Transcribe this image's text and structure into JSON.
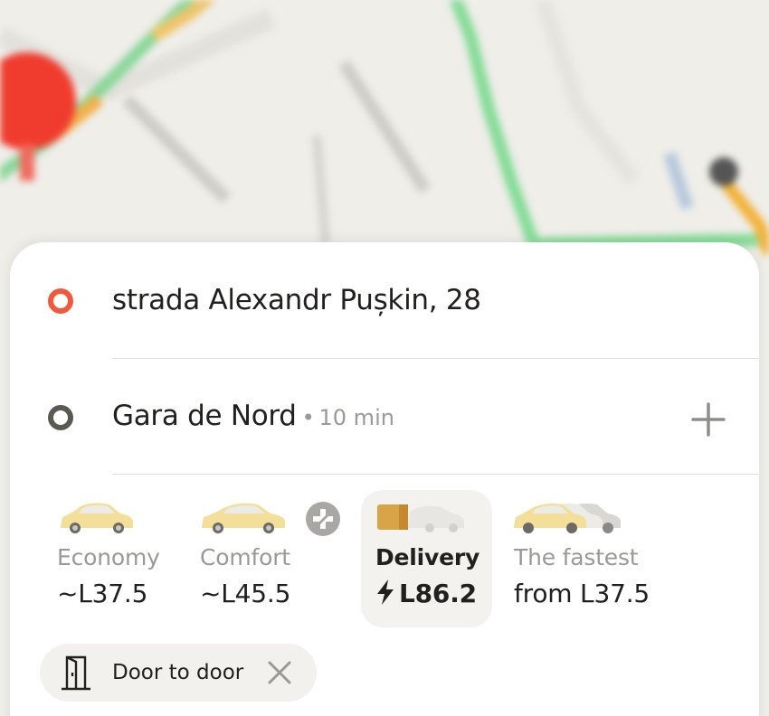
{
  "route": {
    "from": {
      "address": "strada Alexandr Pușkin, 28"
    },
    "to": {
      "address": "Gara de Nord",
      "eta": "10 min",
      "separator": "•"
    }
  },
  "tariffs": [
    {
      "name": "Economy",
      "price": "~L37.5",
      "selected": false
    },
    {
      "name": "Comfort",
      "price": "~L45.5",
      "selected": false,
      "badge": "plus-icon"
    },
    {
      "name": "Delivery",
      "price": "L86.2",
      "selected": true,
      "price_icon": "lightning-icon"
    },
    {
      "name": "The fastest",
      "price": "from L37.5",
      "selected": false
    }
  ],
  "options": [
    {
      "label": "Door to door",
      "icon": "door-icon",
      "removable": true
    }
  ],
  "colors": {
    "origin_marker": "#f0593b",
    "destination_marker": "#5b5a52",
    "map_road_traffic_free": "#7bd88f",
    "map_road_traffic_busy": "#f2b33d",
    "map_pin": "#f03c2e"
  }
}
